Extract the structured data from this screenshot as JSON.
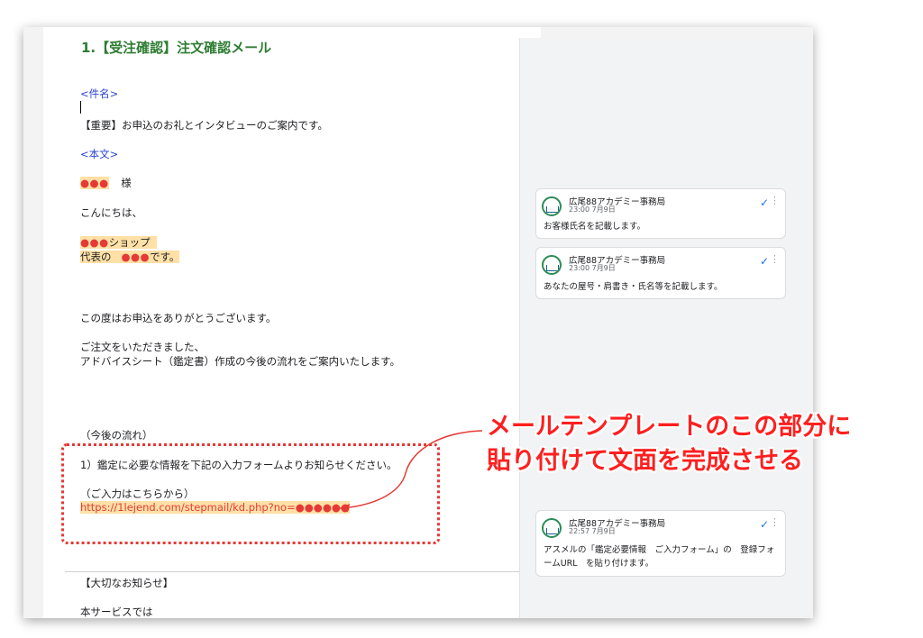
{
  "document": {
    "heading": "1.【受注確認】注文確認メール",
    "subject_label": "<件名>",
    "subject_text": "【重要】お申込のお礼とインタビューのご案内です。",
    "body_label": "<本文>",
    "placeholder_dots": "●●●",
    "honorific": "様",
    "greeting": "こんにちは、",
    "shop_suffix": "ショップ",
    "rep_prefix": "代表の",
    "rep_suffix": "です。",
    "thanks": "この度はお申込をありがとうございます。",
    "order_received": "ご注文をいただきました、",
    "flow_info": "アドバイスシート（鑑定書）作成の今後の流れをご案内いたします。",
    "flow_heading": "（今後の流れ）",
    "step1": "1）鑑定に必要な情報を下記の入力フォームよりお知らせください。",
    "input_here": "（ご入力はこちらから）",
    "url": "https://1lejend.com/stepmail/kd.php?no=●●●●●●",
    "important_notice": "【大切なお知らせ】",
    "cut_text": "本サービスでは"
  },
  "comments": [
    {
      "author": "広尾88アカデミー事務局",
      "time": "23:00 7月9日",
      "text_lines": [
        "お客様氏名を記載します。"
      ]
    },
    {
      "author": "広尾88アカデミー事務局",
      "time": "23:00 7月9日",
      "text_lines": [
        "あなたの屋号・肩書き・氏名等を記載します。"
      ]
    },
    {
      "author": "広尾88アカデミー事務局",
      "time": "22:57 7月9日",
      "text_lines": [
        "アスメルの「鑑定必要情報　ご入力フォーム」の　登録フォ",
        "ームURL　を貼り付けます。"
      ]
    }
  ],
  "annotation": {
    "line1": "メールテンプレートのこの部分に",
    "line2": "貼り付けて文面を完成させる"
  },
  "icons": {
    "resolve": "✓",
    "more": "⋮"
  },
  "colors": {
    "heading": "#2e7d32",
    "label_blue": "#2b44d4",
    "highlight": "#ffe0a6",
    "placeholder_red": "#e53935",
    "annotation_red": "#ff1f1f",
    "resolve_blue": "#1a73e8"
  }
}
